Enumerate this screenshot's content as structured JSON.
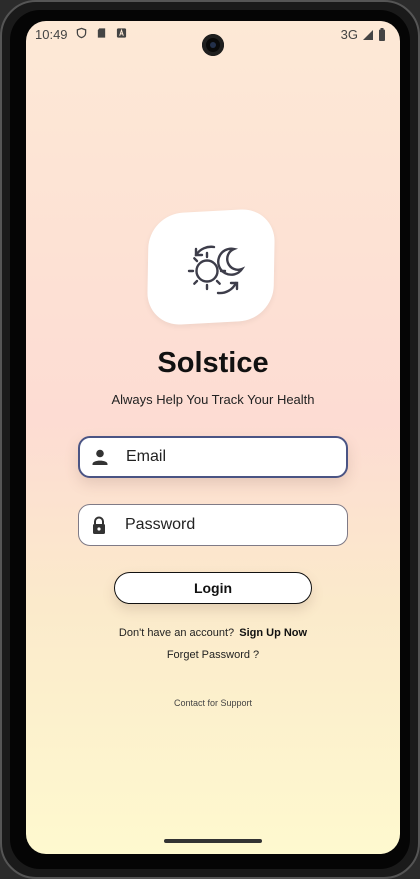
{
  "status_bar": {
    "time": "10:49",
    "network": "3G",
    "left_icons": [
      "shield-icon",
      "sd-card-icon",
      "font-icon"
    ],
    "right_icons": [
      "signal-icon",
      "battery-icon"
    ]
  },
  "app": {
    "title": "Solstice",
    "subtitle": "Always Help You Track Your Health",
    "logo_icon": "sun-moon-cycle-icon"
  },
  "login_form": {
    "email": {
      "placeholder": "Email",
      "value": "",
      "icon": "person-icon",
      "focused": true
    },
    "password": {
      "placeholder": "Password",
      "value": "",
      "icon": "lock-icon"
    },
    "login_label": "Login"
  },
  "links": {
    "no_account_text": "Don't have an account?",
    "signup_label": "Sign Up Now",
    "forget_password_label": "Forget Password ?",
    "support_label": "Contact for Support"
  },
  "colors": {
    "focused_border": "#4a5484",
    "background_top": "#fde9d6",
    "background_bottom": "#fef9cf"
  }
}
